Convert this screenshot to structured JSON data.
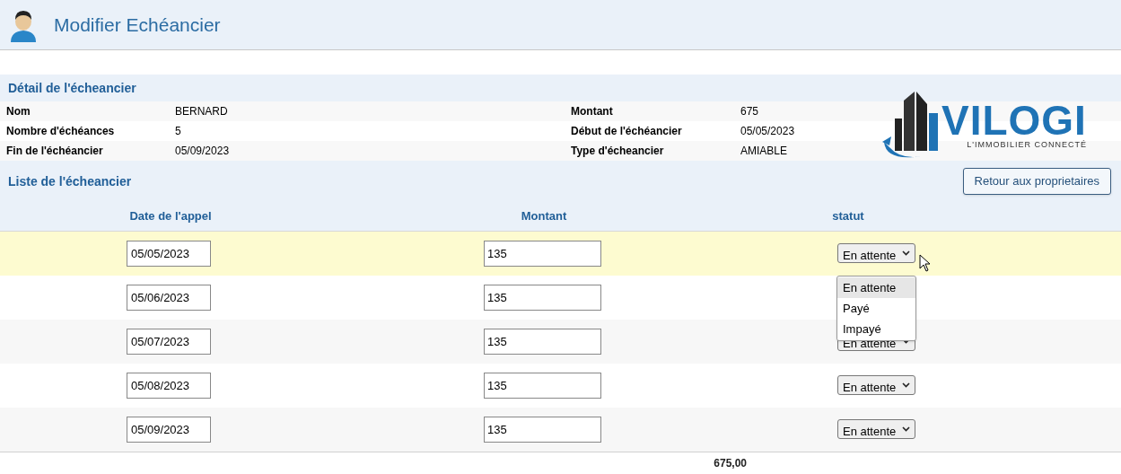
{
  "page_title": "Modifier Echéancier",
  "detail": {
    "title": "Détail de l'écheancier",
    "fields": [
      {
        "label": "Nom",
        "value": "BERNARD"
      },
      {
        "label": "Montant",
        "value": "675"
      },
      {
        "label": "Nombre d'échéances",
        "value": "5"
      },
      {
        "label": "Début de l'échéancier",
        "value": "05/05/2023"
      },
      {
        "label": "Fin de l'échéancier",
        "value": "05/09/2023"
      },
      {
        "label": "Type d'écheancier",
        "value": "AMIABLE"
      }
    ]
  },
  "logo": {
    "name": "VILOGI",
    "tagline": "L'IMMOBILIER CONNECTÉ"
  },
  "list": {
    "title": "Liste de l'écheancier",
    "back_button": "Retour aux proprietaires",
    "columns": [
      "Date de l'appel",
      "Montant",
      "statut"
    ],
    "rows": [
      {
        "date": "05/05/2023",
        "montant": "135",
        "statut": "En attente",
        "selected": true
      },
      {
        "date": "05/06/2023",
        "montant": "135",
        "selected": false
      },
      {
        "date": "05/07/2023",
        "montant": "135",
        "statut": "En attente",
        "selected": false
      },
      {
        "date": "05/08/2023",
        "montant": "135",
        "statut": "En attente",
        "selected": false
      },
      {
        "date": "05/09/2023",
        "montant": "135",
        "statut": "En attente",
        "selected": false
      }
    ],
    "status_menu": {
      "open": true,
      "options": [
        {
          "label": "En attente",
          "selected": true
        },
        {
          "label": "Payé",
          "selected": false
        },
        {
          "label": "Impayé",
          "selected": false
        }
      ]
    },
    "total": "675,00"
  }
}
